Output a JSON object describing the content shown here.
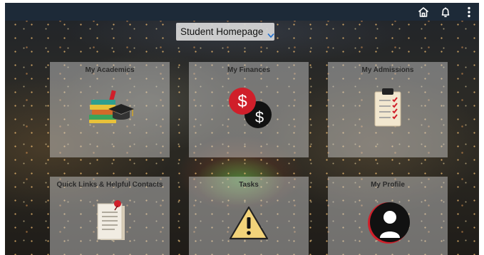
{
  "topbar": {
    "icons": [
      "home-icon",
      "bell-icon",
      "more-vertical-icon"
    ],
    "background": "#1d2a38"
  },
  "header": {
    "page_title": "Student Homepage",
    "dropdown_icon": "chevron-down-icon"
  },
  "tiles": [
    {
      "title": "My Academics",
      "icon": "books-graduation-cap-icon"
    },
    {
      "title": "My Finances",
      "icon": "dollar-coins-icon"
    },
    {
      "title": "My Admissions",
      "icon": "clipboard-checklist-icon"
    },
    {
      "title": "Quick Links & Helpful Contacts",
      "icon": "pinned-notes-icon"
    },
    {
      "title": "Tasks",
      "icon": "warning-icon"
    },
    {
      "title": "My Profile",
      "icon": "user-profile-icon"
    }
  ],
  "colors": {
    "accent_red": "#d01f2a",
    "tile_background": "rgba(205,205,205,0.48)"
  }
}
